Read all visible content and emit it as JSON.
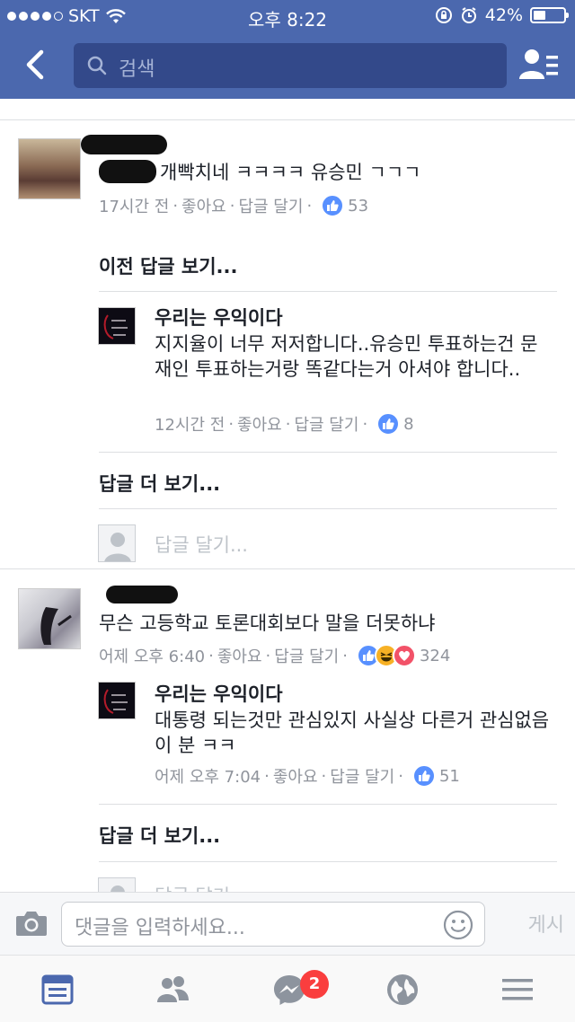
{
  "status_bar": {
    "carrier": "SKT",
    "time": "오후 8:22",
    "battery": "42%",
    "battery_level": 0.42
  },
  "search": {
    "placeholder": "검색"
  },
  "comments": [
    {
      "text": "개빡치네 ㅋㅋㅋㅋ 유승민 ㄱㄱㄱ",
      "time": "17시간 전",
      "like_label": "좋아요",
      "reply_label": "답글 달기",
      "reaction_count": "53",
      "previous_replies": "이전 답글 보기...",
      "replies": [
        {
          "name": "우리는 우익이다",
          "text": "지지율이 너무 저저합니다..유승민 투표하는건 문재인 투표하는거랑 똑같다는거 아셔야 합니다..",
          "time": "12시간 전",
          "like_label": "좋아요",
          "reply_label": "답글 달기",
          "reaction_count": "8"
        }
      ],
      "more_replies": "답글 더 보기...",
      "reply_placeholder": "답글 달기..."
    },
    {
      "text": "무슨 고등학교 토론대회보다 말을 더못하냐",
      "time": "어제 오후 6:40",
      "like_label": "좋아요",
      "reply_label": "답글 달기",
      "reaction_count": "324",
      "replies": [
        {
          "name": "우리는 우익이다",
          "text": "대통령 되는것만 관심있지 사실상 다른거 관심없음 이 분 ㅋㅋ",
          "time": "어제 오후 7:04",
          "like_label": "좋아요",
          "reply_label": "답글 달기",
          "reaction_count": "51"
        }
      ],
      "more_replies": "답글 더 보기...",
      "reply_placeholder": "답글 달기..."
    }
  ],
  "composer": {
    "placeholder": "댓글을 입력하세요...",
    "post_label": "게시"
  },
  "tabbar": {
    "messenger_badge": "2"
  },
  "colors": {
    "header": "#4b68ae",
    "like": "#5890ff",
    "tab_active": "#4b68ae",
    "badge": "#fa3e3e"
  }
}
